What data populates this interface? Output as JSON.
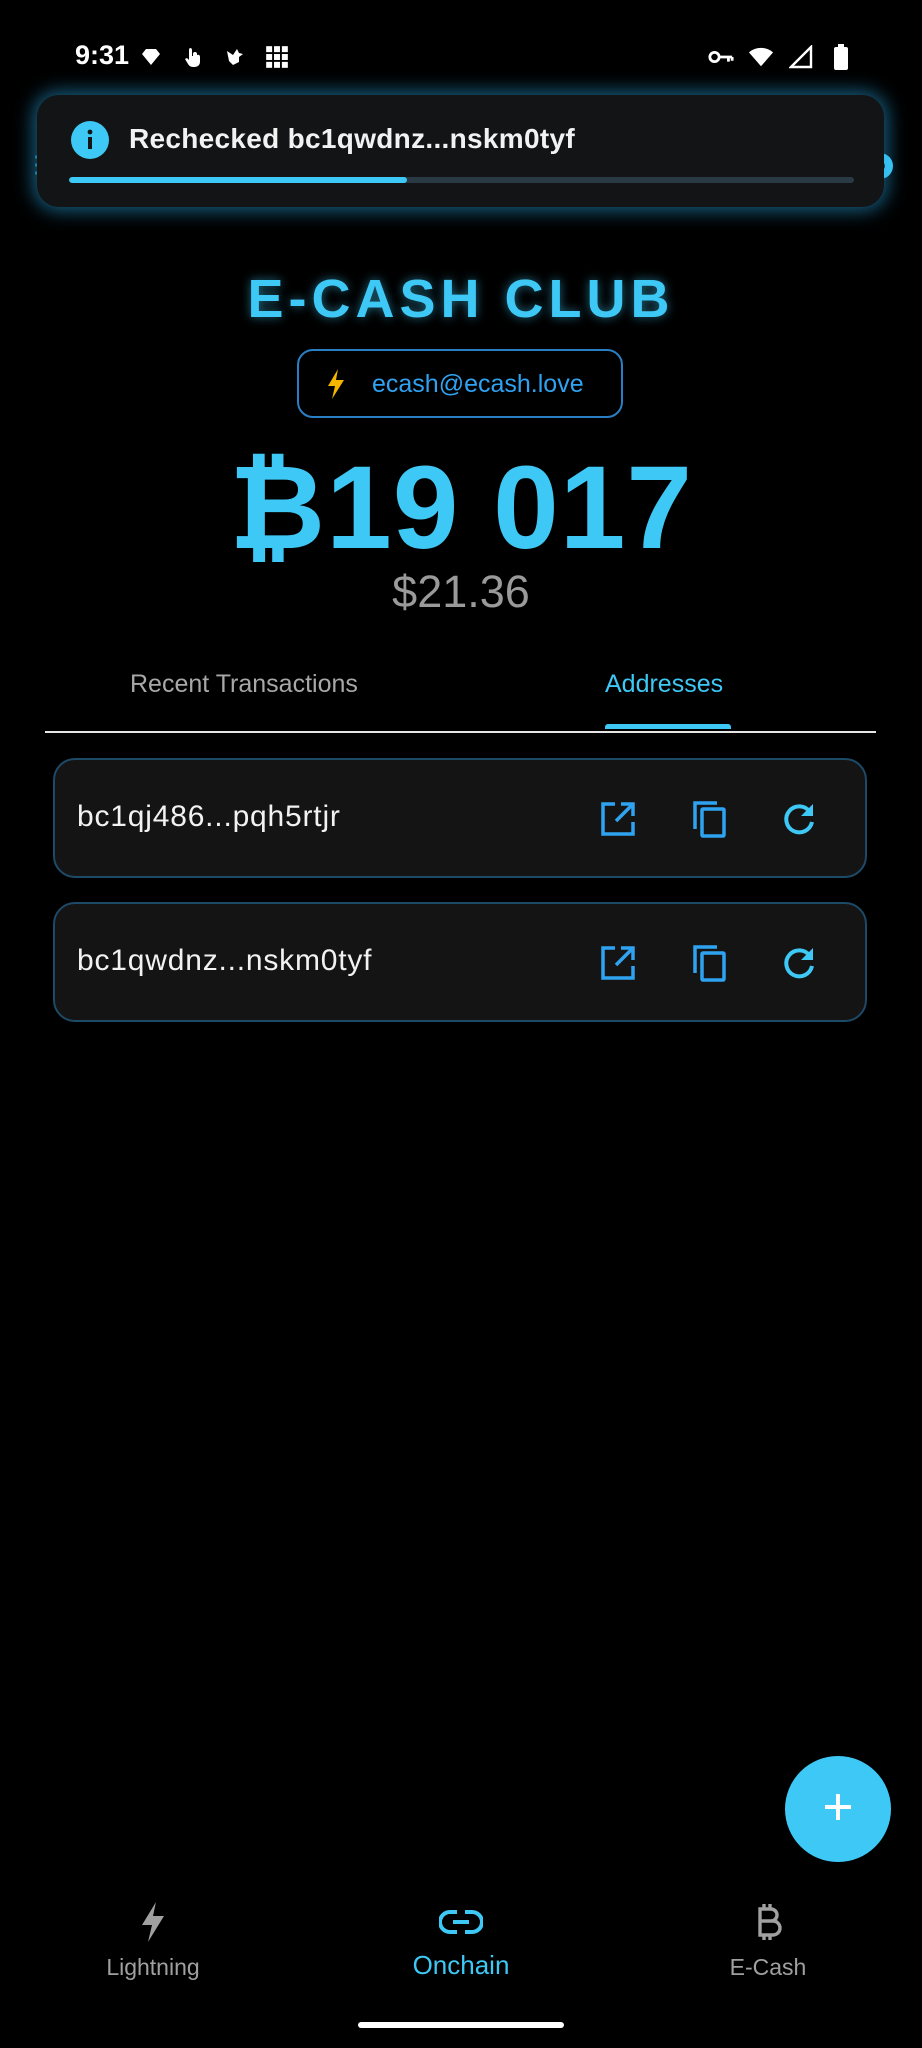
{
  "status_bar": {
    "time": "9:31",
    "left_icons": [
      "diamond-icon",
      "touch-icon",
      "bird-icon",
      "grid-icon"
    ],
    "right_icons": [
      "vpn-key-icon",
      "wifi-icon",
      "signal-icon",
      "battery-icon"
    ]
  },
  "toast": {
    "icon": "info-icon",
    "message": "Rechecked bc1qwdnz...nskm0tyf",
    "progress": 0.43
  },
  "brand": {
    "title": "E-CASH CLUB",
    "lightning_address": "ecash@ecash.love"
  },
  "balance": {
    "amount": "₿19 017",
    "fiat": "$21.36"
  },
  "tabs": {
    "recent": "Recent Transactions",
    "addresses": "Addresses",
    "active": "addresses"
  },
  "addresses": [
    {
      "address": "bc1qj486...pqh5rtjr"
    },
    {
      "address": "bc1qwdnz...nskm0tyf"
    }
  ],
  "fab": {
    "icon": "plus-icon"
  },
  "bottom_nav": {
    "lightning": "Lightning",
    "onchain": "Onchain",
    "ecash": "E-Cash",
    "active": "onchain"
  },
  "colors": {
    "accent": "#3ec8f5",
    "link_blue": "#2fa3f2",
    "bolt_yellow": "#f5b400",
    "background": "#000000"
  }
}
